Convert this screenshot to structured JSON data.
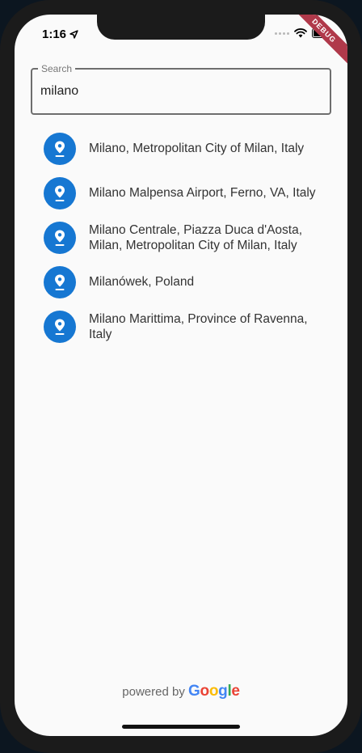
{
  "status_bar": {
    "time": "1:16",
    "location_icon": "location-arrow-icon",
    "wifi_icon": "wifi-icon",
    "battery_icon": "battery-icon"
  },
  "debug_banner": {
    "label": "DEBUG"
  },
  "search": {
    "label": "Search",
    "value": "milano"
  },
  "results": [
    {
      "icon": "location-pin-icon",
      "text": "Milano, Metropolitan City of Milan, Italy"
    },
    {
      "icon": "location-pin-icon",
      "text": "Milano Malpensa Airport, Ferno, VA, Italy"
    },
    {
      "icon": "location-pin-icon",
      "text": "Milano Centrale, Piazza Duca d'Aosta, Milan, Metropolitan City of Milan, Italy"
    },
    {
      "icon": "location-pin-icon",
      "text": "Milanówek, Poland"
    },
    {
      "icon": "location-pin-icon",
      "text": "Milano Marittima, Province of Ravenna, Italy"
    }
  ],
  "footer": {
    "powered_by": "powered by",
    "brand": "Google"
  },
  "colors": {
    "accent": "#1677d2",
    "debug": "#b0394a",
    "google_blue": "#4285F4",
    "google_red": "#EA4335",
    "google_yellow": "#FBBC05",
    "google_green": "#34A853"
  }
}
